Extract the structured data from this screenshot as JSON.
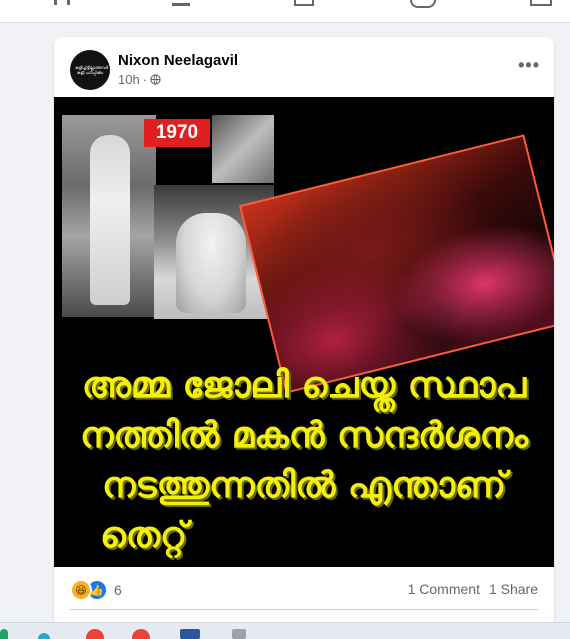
{
  "post": {
    "author": "Nixon Neelagavil",
    "time": "10h",
    "separator": "·",
    "more_label": "•••",
    "avatar_text": "കളിച്ചിട്ടില്ലാത്തവർ കളി പഠിപ്പിക്കും",
    "image": {
      "year_tag": "1970",
      "caption_lines": [
        "അമ്മ ജോലി ചെയ്ത സ്ഥാപ",
        "നത്തിൽ മകൻ സന്ദർശനം",
        "നടത്തുന്നതിൽ എന്താണ്",
        "തെറ്റ്"
      ],
      "caption_color": "#f5f00a"
    },
    "reactions": {
      "icons": [
        "haha-icon",
        "like-icon"
      ],
      "count": "6"
    },
    "comments": "1 Comment",
    "shares": "1 Share"
  },
  "colors": {
    "background": "#f0f2f5",
    "card": "#ffffff",
    "secondary_text": "#65676b",
    "like_blue": "#1877f2"
  }
}
